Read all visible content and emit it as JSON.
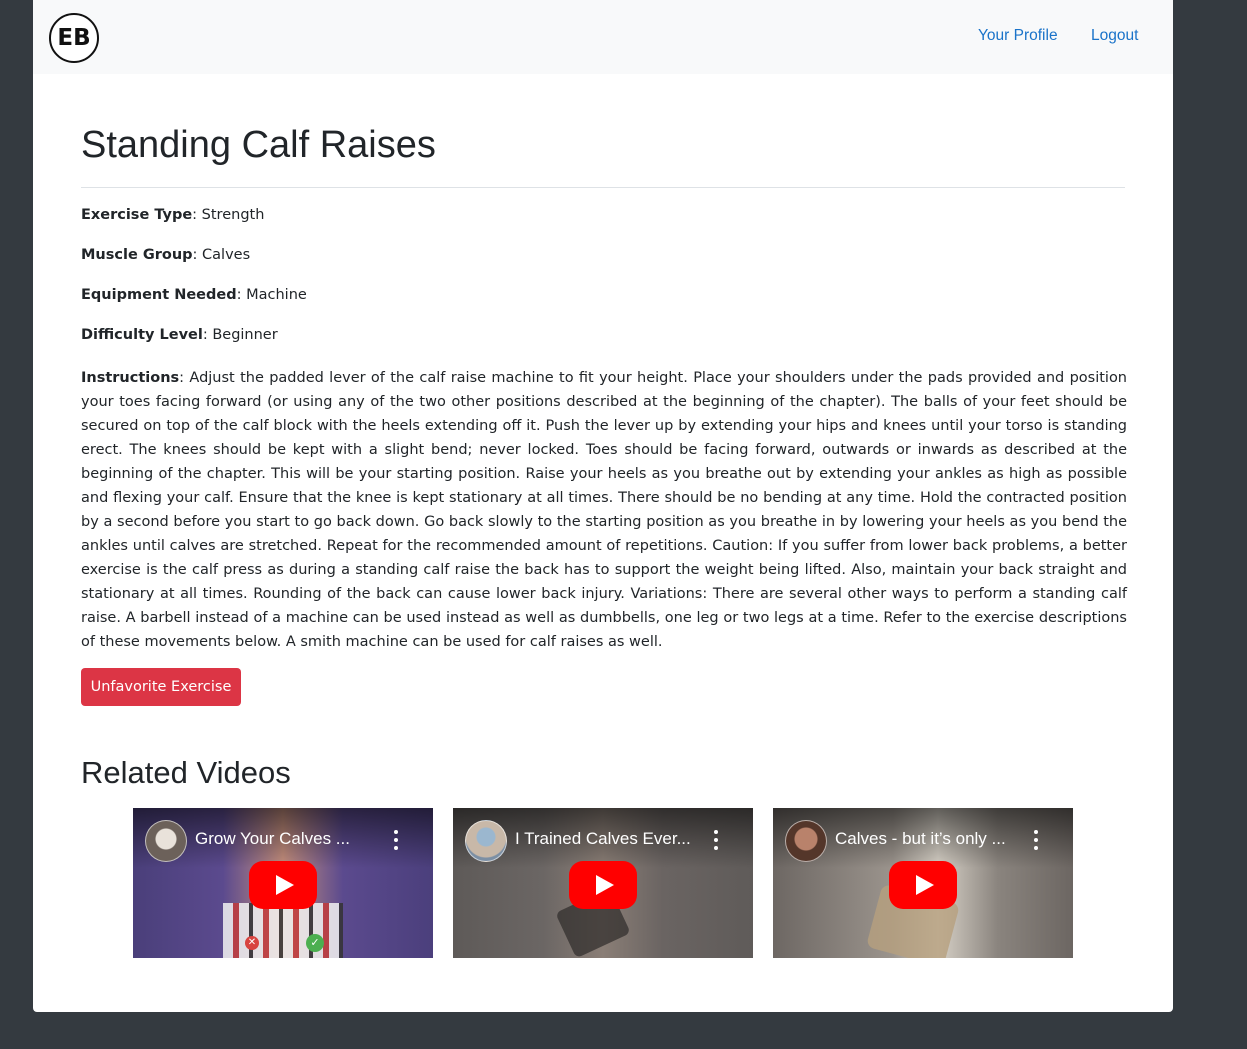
{
  "navbar": {
    "logo_text": "EB",
    "links": {
      "profile": "Your Profile",
      "logout": "Logout"
    }
  },
  "exercise": {
    "title": "Standing Calf Raises",
    "fields": [
      {
        "label": "Exercise Type",
        "value": "Strength"
      },
      {
        "label": "Muscle Group",
        "value": "Calves"
      },
      {
        "label": "Equipment Needed",
        "value": "Machine"
      },
      {
        "label": "Difficulty Level",
        "value": "Beginner"
      }
    ],
    "instructions_label": "Instructions",
    "instructions": "Adjust the padded lever of the calf raise machine to fit your height. Place your shoulders under the pads provided and position your toes facing forward (or using any of the two other positions described at the beginning of the chapter). The balls of your feet should be secured on top of the calf block with the heels extending off it. Push the lever up by extending your hips and knees until your torso is standing erect. The knees should be kept with a slight bend; never locked. Toes should be facing forward, outwards or inwards as described at the beginning of the chapter. This will be your starting position. Raise your heels as you breathe out by extending your ankles as high as possible and flexing your calf. Ensure that the knee is kept stationary at all times. There should be no bending at any time. Hold the contracted position by a second before you start to go back down. Go back slowly to the starting position as you breathe in by lowering your heels as you bend the ankles until calves are stretched. Repeat for the recommended amount of repetitions. Caution: If you suffer from lower back problems, a better exercise is the calf press as during a standing calf raise the back has to support the weight being lifted. Also, maintain your back straight and stationary at all times. Rounding of the back can cause lower back injury. Variations: There are several other ways to perform a standing calf raise. A barbell instead of a machine can be used instead as well as dumbbells, one leg or two legs at a time. Refer to the exercise descriptions of these movements below. A smith machine can be used for calf raises as well.",
    "unfavorite_label": "Unfavorite Exercise"
  },
  "related": {
    "heading": "Related Videos",
    "videos": [
      {
        "title": "Grow Your Calves ..."
      },
      {
        "title": "I Trained Calves Ever..."
      },
      {
        "title": "Calves - but it’s only ..."
      }
    ]
  },
  "colors": {
    "page_bg": "#343a40",
    "navbar_bg": "#f8f9fa",
    "link": "#1a73c9",
    "danger": "#dc3545",
    "youtube_red": "#ff0000"
  }
}
